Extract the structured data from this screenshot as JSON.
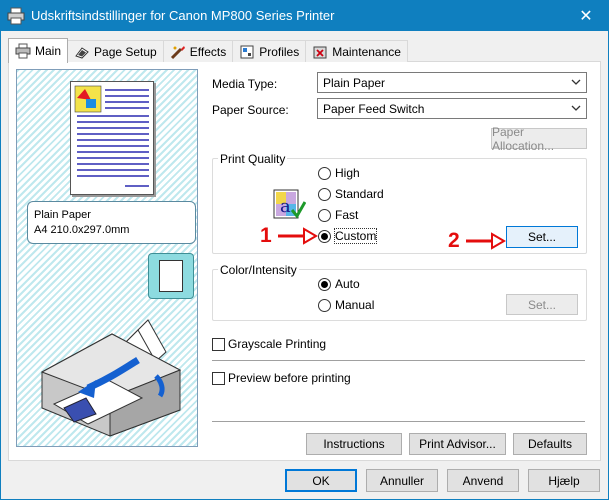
{
  "window": {
    "title": "Udskriftsindstillinger for Canon MP800 Series Printer",
    "close_glyph": "✕"
  },
  "tabs": [
    {
      "label": "Main",
      "icon": "main-icon",
      "active": true
    },
    {
      "label": "Page Setup",
      "icon": "page-setup-icon"
    },
    {
      "label": "Effects",
      "icon": "effects-icon"
    },
    {
      "label": "Profiles",
      "icon": "profiles-icon"
    },
    {
      "label": "Maintenance",
      "icon": "maintenance-icon"
    }
  ],
  "preview": {
    "media_line1": "Plain Paper",
    "media_line2": "A4 210.0x297.0mm"
  },
  "media_type": {
    "label": "Media Type:",
    "value": "Plain Paper"
  },
  "paper_source": {
    "label": "Paper Source:",
    "value": "Paper Feed Switch"
  },
  "paper_allocation_button": "Paper Allocation...",
  "print_quality": {
    "title": "Print Quality",
    "options": [
      "High",
      "Standard",
      "Fast",
      "Custom"
    ],
    "selected": "Custom",
    "set_button": "Set..."
  },
  "color_intensity": {
    "title": "Color/Intensity",
    "options": [
      "Auto",
      "Manual"
    ],
    "selected": "Auto",
    "set_button": "Set..."
  },
  "grayscale_printing": {
    "label": "Grayscale Printing",
    "checked": false
  },
  "preview_before_printing": {
    "label": "Preview before printing",
    "checked": false
  },
  "bottom_buttons": {
    "instructions": "Instructions",
    "print_advisor": "Print Advisor...",
    "defaults": "Defaults"
  },
  "dialog_buttons": {
    "ok": "OK",
    "cancel": "Annuller",
    "apply": "Anvend",
    "help": "Hjælp"
  },
  "annotations": {
    "marker1": "1",
    "marker2": "2"
  },
  "colors": {
    "titlebar": "#0f7fbf",
    "annotation_red": "#e40d0d",
    "preview_hatch": "#bfe8ee",
    "orientation_box": "#8ddbe0"
  }
}
